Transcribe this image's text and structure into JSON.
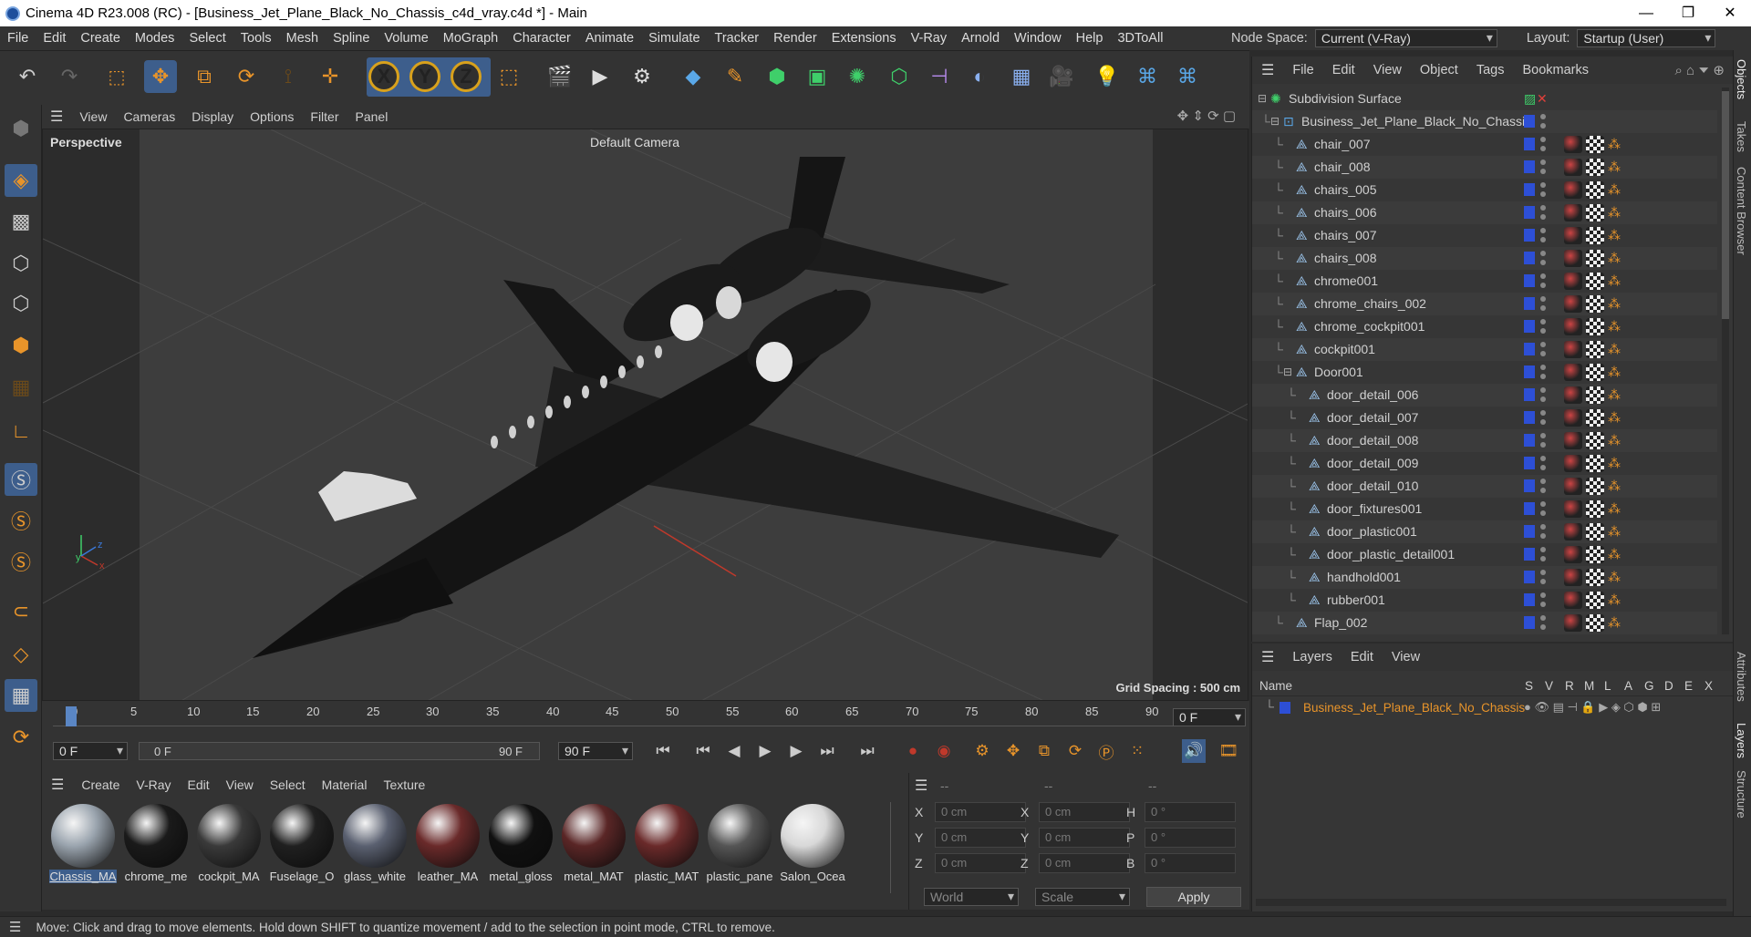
{
  "title": "Cinema 4D R23.008 (RC) - [Business_Jet_Plane_Black_No_Chassis_c4d_vray.c4d *] - Main",
  "window_controls": {
    "minimize": "—",
    "maximize": "❐",
    "close": "✕"
  },
  "menu": [
    "File",
    "Edit",
    "Create",
    "Modes",
    "Select",
    "Tools",
    "Mesh",
    "Spline",
    "Volume",
    "MoGraph",
    "Character",
    "Animate",
    "Simulate",
    "Tracker",
    "Render",
    "Extensions",
    "V-Ray",
    "Arnold",
    "Window",
    "Help",
    "3DToAll"
  ],
  "node_space": {
    "label": "Node Space:",
    "value": "Current (V-Ray)"
  },
  "layout": {
    "label": "Layout:",
    "value": "Startup (User)"
  },
  "viewport": {
    "menu": [
      "View",
      "Cameras",
      "Display",
      "Options",
      "Filter",
      "Panel"
    ],
    "name": "Perspective",
    "camera": "Default Camera",
    "grid_spacing": "Grid Spacing : 500 cm"
  },
  "timeline": {
    "ticks": [
      "0",
      "5",
      "10",
      "15",
      "20",
      "25",
      "30",
      "35",
      "40",
      "45",
      "50",
      "55",
      "60",
      "65",
      "70",
      "75",
      "80",
      "85",
      "90"
    ],
    "current_frame": "0 F",
    "start_frame": "0 F",
    "range_start": "0 F",
    "range_end": "90 F",
    "end_frame": "90 F"
  },
  "material_manager": {
    "menu": [
      "Create",
      "V-Ray",
      "Edit",
      "View",
      "Select",
      "Material",
      "Texture"
    ],
    "materials": [
      {
        "name": "Chassis_MA",
        "color": "#9aa4ae"
      },
      {
        "name": "chrome_me",
        "color": "#1a1a1a"
      },
      {
        "name": "cockpit_MA",
        "color": "#3a3a3a"
      },
      {
        "name": "Fuselage_O",
        "color": "#202020"
      },
      {
        "name": "glass_white",
        "color": "#5a6070"
      },
      {
        "name": "leather_MA",
        "color": "#6a2a2a"
      },
      {
        "name": "metal_gloss",
        "color": "#101010"
      },
      {
        "name": "metal_MAT",
        "color": "#5a2626"
      },
      {
        "name": "plastic_MAT",
        "color": "#6a2a2a"
      },
      {
        "name": "plastic_pane",
        "color": "#555555"
      },
      {
        "name": "Salon_Ocea",
        "color": "#d8d8d8"
      }
    ]
  },
  "coord_manager": {
    "headers": [
      "--",
      "--",
      "--"
    ],
    "rows": [
      {
        "a": "X",
        "av": "0 cm",
        "b": "X",
        "bv": "0 cm",
        "c": "H",
        "cv": "0 °"
      },
      {
        "a": "Y",
        "av": "0 cm",
        "b": "Y",
        "bv": "0 cm",
        "c": "P",
        "cv": "0 °"
      },
      {
        "a": "Z",
        "av": "0 cm",
        "b": "Z",
        "bv": "0 cm",
        "c": "B",
        "cv": "0 °"
      }
    ],
    "world": "World",
    "scale": "Scale",
    "apply": "Apply"
  },
  "objects": {
    "menu": [
      "File",
      "Edit",
      "View",
      "Object",
      "Tags",
      "Bookmarks"
    ],
    "items": [
      {
        "name": "Subdivision Surface",
        "indent": 0
      },
      {
        "name": "Business_Jet_Plane_Black_No_Chassis",
        "indent": 1
      },
      {
        "name": "chair_007",
        "indent": 2
      },
      {
        "name": "chair_008",
        "indent": 2
      },
      {
        "name": "chairs_005",
        "indent": 2
      },
      {
        "name": "chairs_006",
        "indent": 2
      },
      {
        "name": "chairs_007",
        "indent": 2
      },
      {
        "name": "chairs_008",
        "indent": 2
      },
      {
        "name": "chrome001",
        "indent": 2
      },
      {
        "name": "chrome_chairs_002",
        "indent": 2
      },
      {
        "name": "chrome_cockpit001",
        "indent": 2
      },
      {
        "name": "cockpit001",
        "indent": 2
      },
      {
        "name": "Door001",
        "indent": 2
      },
      {
        "name": "door_detail_006",
        "indent": 3
      },
      {
        "name": "door_detail_007",
        "indent": 3
      },
      {
        "name": "door_detail_008",
        "indent": 3
      },
      {
        "name": "door_detail_009",
        "indent": 3
      },
      {
        "name": "door_detail_010",
        "indent": 3
      },
      {
        "name": "door_fixtures001",
        "indent": 3
      },
      {
        "name": "door_plastic001",
        "indent": 3
      },
      {
        "name": "door_plastic_detail001",
        "indent": 3
      },
      {
        "name": "handhold001",
        "indent": 3
      },
      {
        "name": "rubber001",
        "indent": 3
      },
      {
        "name": "Flap_002",
        "indent": 2
      }
    ]
  },
  "layers": {
    "menu": [
      "Layers",
      "Edit",
      "View"
    ],
    "columns": [
      "Name",
      "S",
      "V",
      "R",
      "M",
      "L",
      "A",
      "G",
      "D",
      "E",
      "X"
    ],
    "rows": [
      {
        "name": "Business_Jet_Plane_Black_No_Chassis"
      }
    ]
  },
  "right_tabs": [
    "Objects",
    "Takes",
    "Content Browser",
    "Attributes",
    "Layers",
    "Structure"
  ],
  "status": "Move: Click and drag to move elements. Hold down SHIFT to quantize movement / add to the selection in point mode, CTRL to remove.",
  "colors": {
    "accent": "#3d5e8c",
    "layer_name": "#e8942a",
    "swatch": "#2d4fd6"
  }
}
